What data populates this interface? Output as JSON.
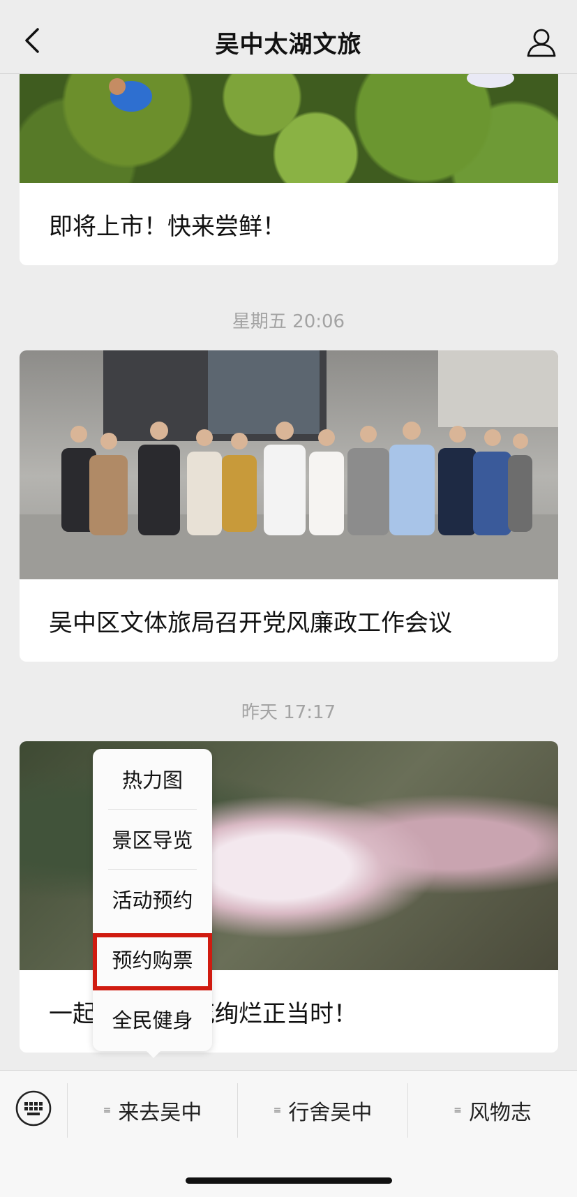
{
  "header": {
    "title": "吴中太湖文旅"
  },
  "feed": {
    "items": [
      {
        "caption": "即将上市！快来尝鲜！"
      },
      {
        "timestamp": "星期五 20:06",
        "caption": "吴中区文体旅局召开党风廉政工作会议"
      },
      {
        "timestamp": "昨天 17:17",
        "caption": "一起赏荷，荷花绚烂正当时！"
      }
    ]
  },
  "popup_menu": {
    "items": [
      "热力图",
      "景区导览",
      "活动预约",
      "预约购票",
      "全民健身"
    ],
    "highlighted": "预约购票"
  },
  "menubar": {
    "items": [
      "来去吴中",
      "行舍吴中",
      "风物志"
    ]
  },
  "colors": {
    "highlight": "#d01b10",
    "background": "#ededed"
  }
}
